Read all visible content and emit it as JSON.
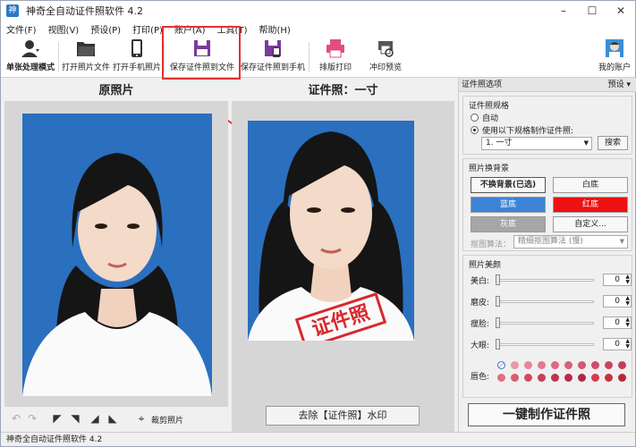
{
  "window": {
    "title": "神奇全自动证件照软件 4.2",
    "app_icon": "神"
  },
  "menu": [
    "文件(F)",
    "视图(V)",
    "预设(P)",
    "打印(P)",
    "账户(A)",
    "工具(T)",
    "帮助(H)"
  ],
  "toolbar": {
    "mode_label": "单张处理模式",
    "open_photo": "打开照片文件",
    "open_phone": "打开手机照片",
    "save_file": "保存证件照到文件",
    "save_phone": "保存证件照到手机",
    "layout_print": "排版打印",
    "print_preview": "冲印预览",
    "account": "我的账户"
  },
  "left_panel": {
    "title": "原照片",
    "crop_label": "裁剪照片"
  },
  "mid_panel": {
    "title": "证件照：一寸",
    "stamp_text": "证件照",
    "remove_watermark": "去除【证件照】水印"
  },
  "right_panel": {
    "header": "证件照选项",
    "preset": "预设",
    "spec_group": "证件照规格",
    "auto_label": "自动",
    "use_spec_label": "使用以下规格制作证件照:",
    "spec_value": "1. 一寸",
    "search_btn": "搜索",
    "bg_group": "照片换背景",
    "bg_none": "不换背景(已选)",
    "bg_white": "白底",
    "bg_blue": "蓝底",
    "bg_red": "红底",
    "bg_gray": "灰底",
    "bg_custom": "自定义...",
    "algo_label": "抠图算法：",
    "algo_value": "精细抠图算法 (慢)",
    "beauty_group": "照片美颜",
    "sliders": [
      {
        "label": "美白:",
        "value": "0"
      },
      {
        "label": "磨皮:",
        "value": "0"
      },
      {
        "label": "瘦脸:",
        "value": "0"
      },
      {
        "label": "大眼:",
        "value": "0"
      }
    ],
    "lip_label": "唇色:",
    "make_btn": "一键制作证件照"
  },
  "status": {
    "text": "神奇全自动证件照软件 4.2"
  },
  "colors": {
    "photo_bg": "#2b6fbf",
    "bg_blue": "#3d83d6",
    "bg_red": "#ee1111",
    "bg_gray": "#a6a6a6",
    "highlight": "#e53030",
    "stamp": "#d8282c"
  },
  "lip_colors": [
    "#ffffff",
    "#e89aa6",
    "#e8849a",
    "#e07b8f",
    "#de6a86",
    "#d8607a",
    "#d25a70",
    "#cc5068",
    "#c64860",
    "#c03f58",
    "#e07080",
    "#d86070",
    "#d04a60",
    "#c84058",
    "#c03350",
    "#b82c48",
    "#b02a40",
    "#d83a4a",
    "#c8303e",
    "#b82834"
  ]
}
